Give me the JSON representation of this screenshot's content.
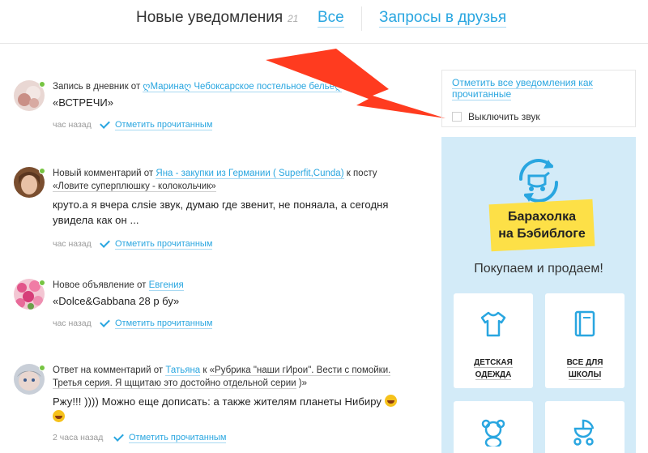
{
  "tabs": {
    "active": "Новые уведомления",
    "count": "21",
    "all": "Все",
    "requests": "Запросы в друзья"
  },
  "notifications": [
    {
      "prefix": "Запись в дневник от ",
      "author": "ღМаринаღ Чебоксарское постельное бельеღ",
      "title": "«ВСТРЕЧИ»",
      "time": "час назад",
      "action": "Отметить прочитанным"
    },
    {
      "prefix": "Новый комментарий от ",
      "author": "Яна - закупки из Германии ( Superfit,Cunda)",
      "middle": " к посту ",
      "post": "«Ловите суперплюшку - колокольчик»",
      "text": "круто.а я вчера слsie звук, думаю где звенит, не поняала, а сегодня увидела как он ...",
      "time": "час назад",
      "action": "Отметить прочитанным"
    },
    {
      "prefix": "Новое объявление от ",
      "author": "Евгения",
      "title": "«Dolce&Gabbana 28 р бу»",
      "time": "час назад",
      "action": "Отметить прочитанным"
    },
    {
      "prefix": "Ответ на комментарий от ",
      "author": "Татьяна",
      "middle": " к ",
      "post": "«Рубрика \"наши гИрои\". Вести с помойки. Третья серия. Я щщитаю это достойно отдельной серии",
      "post_end": " )»",
      "text": "Ржу!!! )))) Можно еще дописать: а также жителям планеты Нибиру",
      "time": "2 часа назад",
      "action": "Отметить прочитанным"
    }
  ],
  "settings": {
    "mark_all": "Отметить все уведомления как прочитанные",
    "mute": "Выключить звук"
  },
  "promo": {
    "badge_line1": "Барахолка",
    "badge_line2": "на Бэбиблоге",
    "slogan": "Покупаем и продаем!",
    "cards": [
      {
        "line1": "ДЕТСКАЯ",
        "line2": "ОДЕЖДА",
        "icon": "shirt-icon"
      },
      {
        "line1": "ВСЕ ДЛЯ",
        "line2": "ШКОЛЫ",
        "icon": "book-icon"
      },
      {
        "icon": "teddy-bear-icon"
      },
      {
        "icon": "stroller-icon"
      }
    ]
  },
  "colors": {
    "link": "#29a6e0",
    "online": "#76c442",
    "promo_bg": "#d3ebf8",
    "badge": "#fde047",
    "arrow": "#ff3b1f"
  }
}
